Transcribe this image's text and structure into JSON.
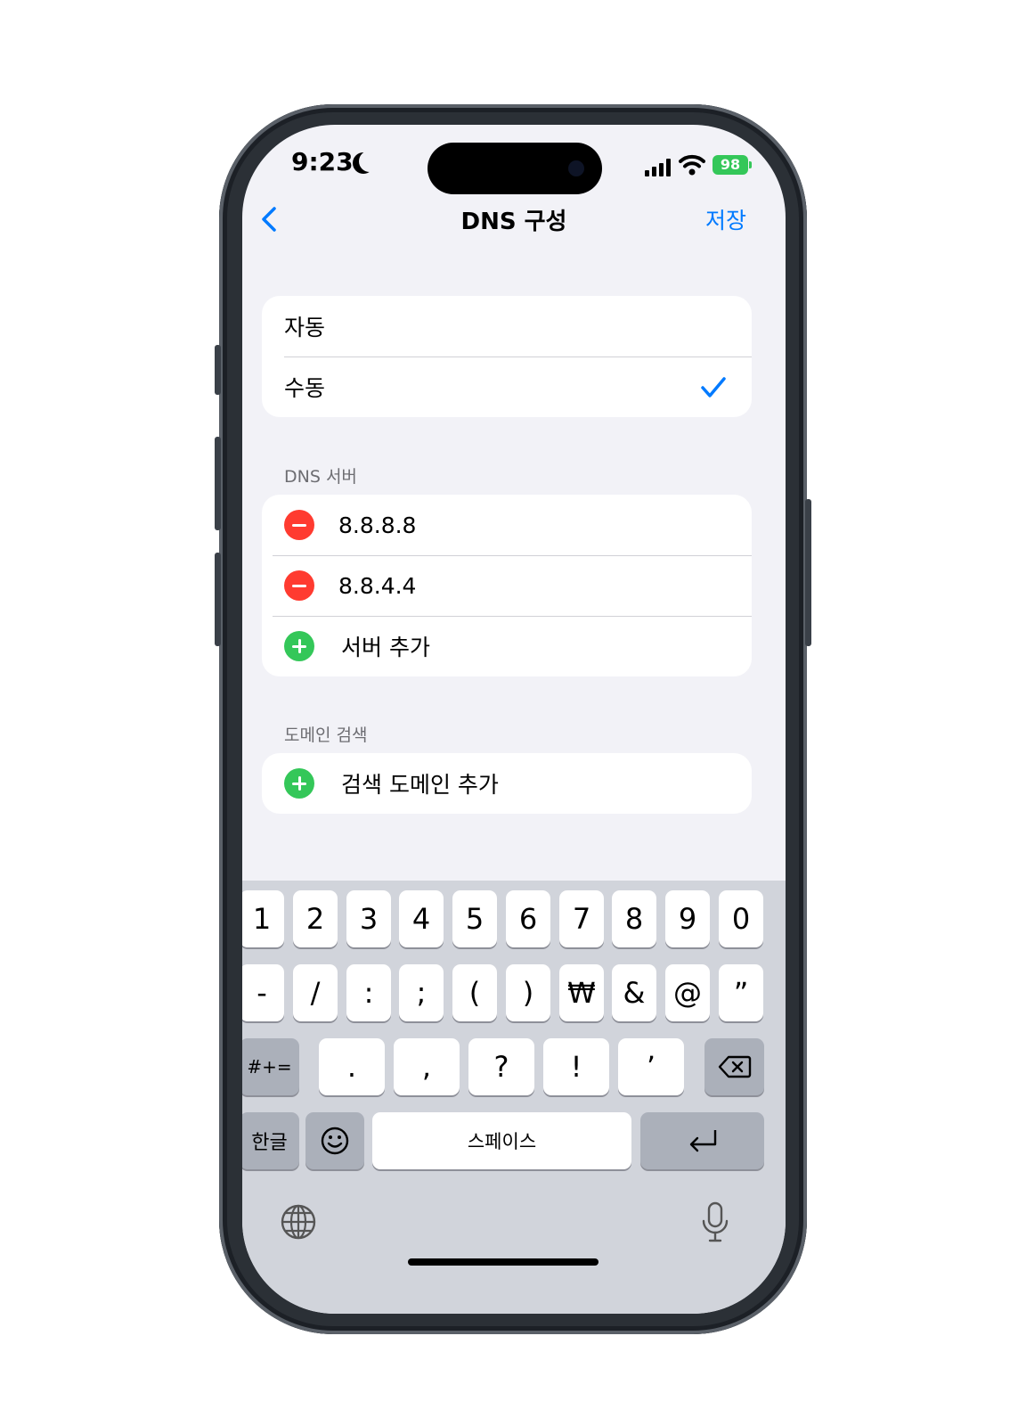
{
  "status_bar": {
    "time": "9:23",
    "battery": "98"
  },
  "nav": {
    "title": "DNS 구성",
    "save_label": "저장"
  },
  "mode": {
    "options": [
      "자동",
      "수동"
    ],
    "selected": "수동"
  },
  "dns_servers": {
    "header": "DNS 서버",
    "servers": [
      "8.8.8.8",
      "8.8.4.4"
    ],
    "add_label": "서버 추가"
  },
  "search_domains": {
    "header": "도메인 검색",
    "add_label": "검색 도메인 추가"
  },
  "keyboard": {
    "row1": [
      "1",
      "2",
      "3",
      "4",
      "5",
      "6",
      "7",
      "8",
      "9",
      "0"
    ],
    "row2": [
      "-",
      "/",
      ":",
      ";",
      "(",
      ")",
      "₩",
      "&",
      "@",
      "”"
    ],
    "row3": {
      "shift": "#+=",
      "keys": [
        ".",
        ",",
        "?",
        "!",
        "’"
      ]
    },
    "row4": {
      "lang": "한글",
      "space": "스페이스"
    }
  },
  "colors": {
    "accent": "#007aff",
    "remove": "#ff3b30",
    "add": "#34c759",
    "background": "#f2f2f7"
  }
}
